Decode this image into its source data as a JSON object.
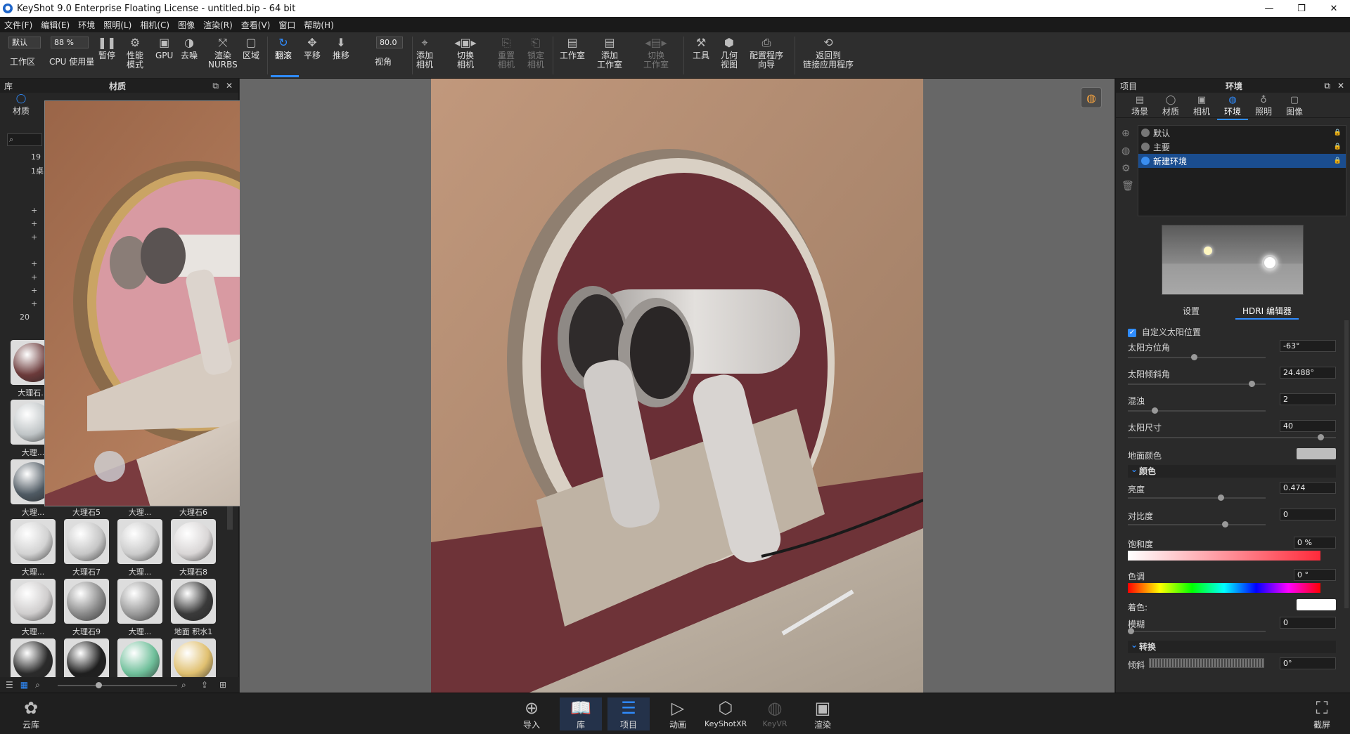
{
  "window": {
    "title": "KeyShot 9.0 Enterprise Floating License  - untitled.bip  - 64 bit",
    "controls": [
      "—",
      "❐",
      "✕"
    ]
  },
  "menu": [
    "文件(F)",
    "编辑(E)",
    "环境",
    "照明(L)",
    "相机(C)",
    "图像",
    "渲染(R)",
    "查看(V)",
    "窗口",
    "帮助(H)"
  ],
  "toolbar": {
    "workspace_value": "默认",
    "workspace_label": "工作区",
    "cpu_value": "88 %",
    "cpu_label": "CPU 使用量",
    "pause": "暂停",
    "perf_mode": "性能\n模式",
    "gpu": "GPU",
    "denoise": "去噪",
    "render_nurbs": "渲染\nNURBS",
    "region": "区域",
    "tumble": "翻滚",
    "pan": "平移",
    "dolly": "推移",
    "fov_value": "80.0",
    "fov_label": "视角",
    "add_camera": "添加\n相机",
    "switch_camera": "切换\n相机",
    "reset_camera": "重置\n相机",
    "lock_camera": "锁定\n相机",
    "studio": "工作室",
    "add_studio": "添加\n工作室",
    "switch_studio": "切换\n工作室",
    "tools": "工具",
    "geometry_view": "几何\n视图",
    "config_wizard": "配置程序\n向导",
    "back_to_app": "返回到\n链接应用程序"
  },
  "left_panel": {
    "header_left": "库",
    "header_center": "材质",
    "tab_material": "材质",
    "tree_items": [
      "19",
      "1桌",
      "",
      "",
      "+",
      "+",
      "+",
      "",
      "+",
      "+",
      "+",
      "+",
      "20"
    ],
    "thumbs": [
      {
        "label": "大理石...",
        "color": "#6b3a3a"
      },
      {
        "label": "大理...",
        "color": "#bfc4c6"
      },
      {
        "label": "大理...",
        "color": "#4f5a63"
      },
      {
        "label": "大理石5",
        "color": "#c9c9c9"
      },
      {
        "label": "大理...",
        "color": "#cfcfcf"
      },
      {
        "label": "大理石6",
        "color": "#d6d6d6"
      },
      {
        "label": "大理...",
        "color": "#d2d2d2"
      },
      {
        "label": "大理石7",
        "color": "#c6c6c6"
      },
      {
        "label": "大理...",
        "color": "#cbcbcb"
      },
      {
        "label": "大理石8",
        "color": "#d9d6d6"
      },
      {
        "label": "大理...",
        "color": "#cfcdcd"
      },
      {
        "label": "大理石9",
        "color": "#8a8a8a"
      },
      {
        "label": "大理...",
        "color": "#9a9a9a"
      },
      {
        "label": "地面 积水1",
        "color": "#3a3a3a"
      },
      {
        "label": "",
        "color": "#2b2b2b"
      },
      {
        "label": "",
        "color": "#1f1f1f"
      },
      {
        "label": "",
        "color": "#6fbf9a"
      },
      {
        "label": "",
        "color": "#e0c070"
      }
    ]
  },
  "right_panel": {
    "header_left": "项目",
    "header_center": "环境",
    "tabs": [
      "场景",
      "材质",
      "相机",
      "环境",
      "照明",
      "图像"
    ],
    "env_items": [
      "默认",
      "主要",
      "新建环境"
    ],
    "subtabs": [
      "设置",
      "HDRI 编辑器"
    ],
    "custom_sun": "自定义太阳位置",
    "props": {
      "azimuth_label": "太阳方位角",
      "azimuth": "-63°",
      "elevation_label": "太阳倾斜角",
      "elevation": "24.488°",
      "turbidity_label": "混浊",
      "turbidity": "2",
      "sunsize_label": "太阳尺寸",
      "sunsize": "40",
      "ground_label": "地面颜色",
      "color_section": "颜色",
      "brightness_label": "亮度",
      "brightness": "0.474",
      "contrast_label": "对比度",
      "contrast": "0",
      "saturation_label": "饱和度",
      "saturation": "0 %",
      "hue_label": "色调",
      "hue": "0 °",
      "tint_label": "着色:",
      "blur_label": "模糊",
      "blur": "0",
      "transform_section": "转换",
      "tilt_label": "倾斜",
      "tilt": "0°"
    }
  },
  "bottom_bar": {
    "cloud": "云库",
    "import": "导入",
    "library": "库",
    "project": "项目",
    "animation": "动画",
    "keyshotxr": "KeyShotXR",
    "keyvr": "KeyVR",
    "render": "渲染",
    "screenshot": "截屏"
  },
  "colors": {
    "accent": "#2f8cff",
    "selection": "#1a4d8f"
  }
}
